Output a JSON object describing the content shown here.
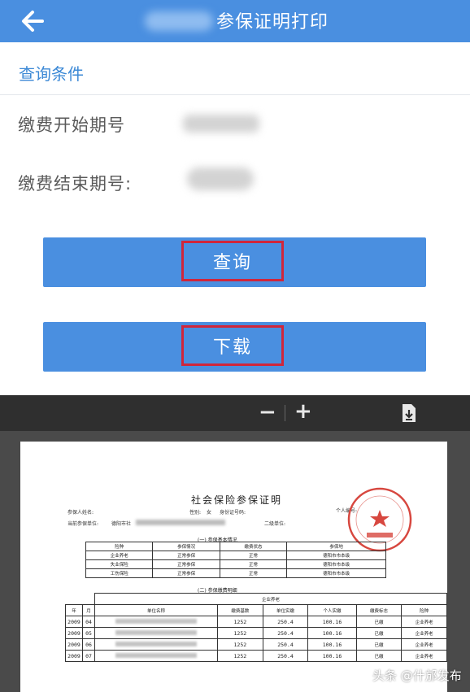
{
  "header": {
    "title": "参保证明打印"
  },
  "query": {
    "section_title": "查询条件",
    "start_label": "缴费开始期号",
    "end_label": "缴费结束期号:"
  },
  "buttons": {
    "query": "查询",
    "download": "下载"
  },
  "viewer": {
    "zoom_out": "−",
    "zoom_in": "+",
    "document": {
      "title": "社会保险参保证明",
      "insured_name_label": "参保人姓名:",
      "gender_label": "性别:",
      "gender_value": "女",
      "id_label": "身份证号码:",
      "personal_no_label": "个人编号:",
      "current_unit_label": "当前参保单位:",
      "current_unit_value": "德阳市社",
      "secondary_unit_label": "二级单位:",
      "section1_caption": "(一)   参保基本情况",
      "section2_caption": "(二)   参保缴费明细",
      "basic_table": {
        "headers": [
          "险种",
          "参保情况",
          "缴费状态",
          "参保地"
        ],
        "rows": [
          [
            "企业养老",
            "正常参保",
            "正常",
            "德阳市市本级"
          ],
          [
            "失业保险",
            "正常参保",
            "正常",
            "德阳市市本级"
          ],
          [
            "工伤保险",
            "正常参保",
            "正常",
            "德阳市市本级"
          ]
        ]
      },
      "detail_table": {
        "group_header": "企业养老",
        "headers": [
          "年",
          "月",
          "单位名称",
          "缴费基数",
          "单位实缴",
          "个人实缴",
          "缴费标志",
          "险种"
        ],
        "rows": [
          [
            "2009",
            "04",
            "",
            "1252",
            "250.4",
            "100.16",
            "已缴",
            "企业养老"
          ],
          [
            "2009",
            "05",
            "",
            "1252",
            "250.4",
            "100.16",
            "已缴",
            "企业养老"
          ],
          [
            "2009",
            "06",
            "",
            "1252",
            "250.4",
            "100.16",
            "已缴",
            "企业养老"
          ],
          [
            "2009",
            "07",
            "",
            "1252",
            "250.4",
            "100.16",
            "已缴",
            "企业养老"
          ]
        ]
      }
    }
  },
  "watermark": "头条 @什邡发布",
  "colors": {
    "accent": "#4a8fe0",
    "highlight_border": "#d0263b",
    "stamp": "#d7473f"
  }
}
